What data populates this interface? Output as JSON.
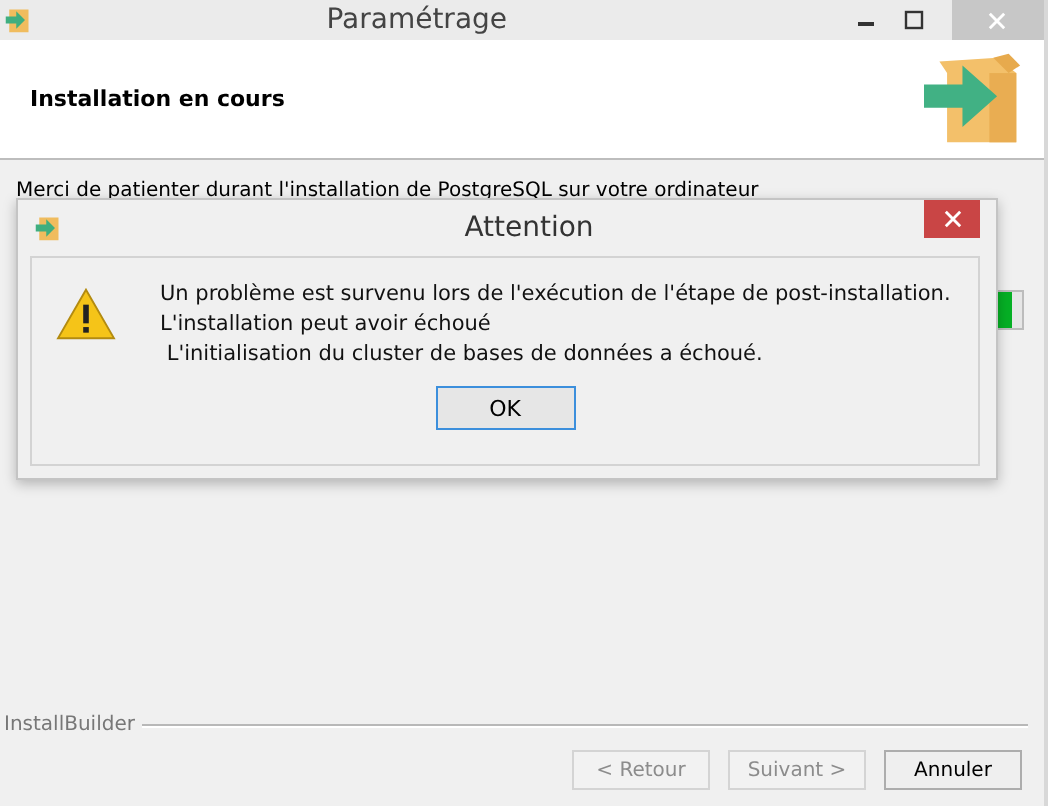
{
  "window": {
    "title": "Paramétrage"
  },
  "header": {
    "title": "Installation en cours"
  },
  "body": {
    "message": "Merci de patienter durant l'installation de PostgreSQL sur votre ordinateur",
    "progress": {
      "level": 0.99
    }
  },
  "dialog": {
    "title": "Attention",
    "lines": [
      "Un problème est survenu lors de l'exécution de l'étape de post-installation.",
      "L'installation peut avoir échoué",
      " L'initialisation du cluster de bases de données a échoué."
    ],
    "button": "OK"
  },
  "footer": {
    "brand": "InstallBuilder",
    "buttons": [
      {
        "label": "< Retour",
        "disabled": true
      },
      {
        "label": "Suivant >",
        "disabled": true
      },
      {
        "label": "Annuler",
        "disabled": false
      }
    ]
  }
}
